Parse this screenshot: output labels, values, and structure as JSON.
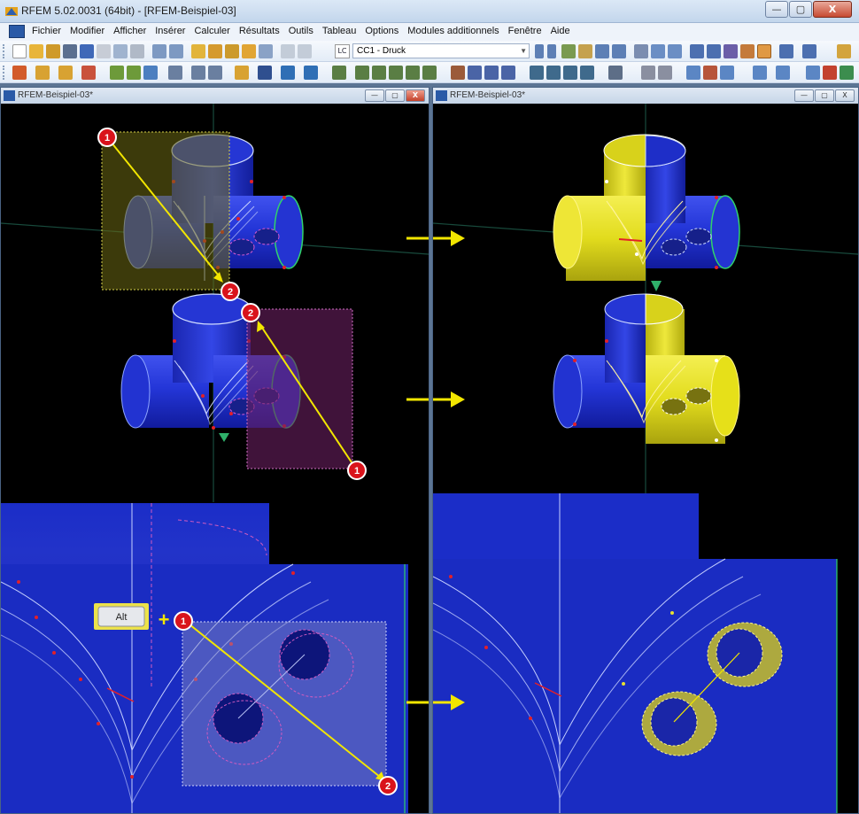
{
  "window": {
    "title": "RFEM 5.02.0031 (64bit) - [RFEM-Beispiel-03]",
    "minimize": "—",
    "maximize": "▢",
    "close": "X"
  },
  "menu": {
    "items": [
      "Fichier",
      "Modifier",
      "Afficher",
      "Insérer",
      "Calculer",
      "Résultats",
      "Outils",
      "Tableau",
      "Options",
      "Modules additionnels",
      "Fenêtre",
      "Aide"
    ]
  },
  "toolbar": {
    "loadcase_icon": "LC",
    "loadcase_value": "CC1 - Druck",
    "dropdown_arrow": "▼"
  },
  "views": {
    "left_title": "RFEM-Beispiel-03*",
    "right_title": "RFEM-Beispiel-03*"
  },
  "annotations": {
    "marker_1": "1",
    "marker_2": "2",
    "alt_key": "Alt",
    "plus": "+"
  },
  "colors": {
    "model_blue": "#1f2fd1",
    "selection_yellow": "#e6e019",
    "arrow_yellow": "#f2e600",
    "marker_red": "#d9131b",
    "viewport_bg": "#000000"
  }
}
